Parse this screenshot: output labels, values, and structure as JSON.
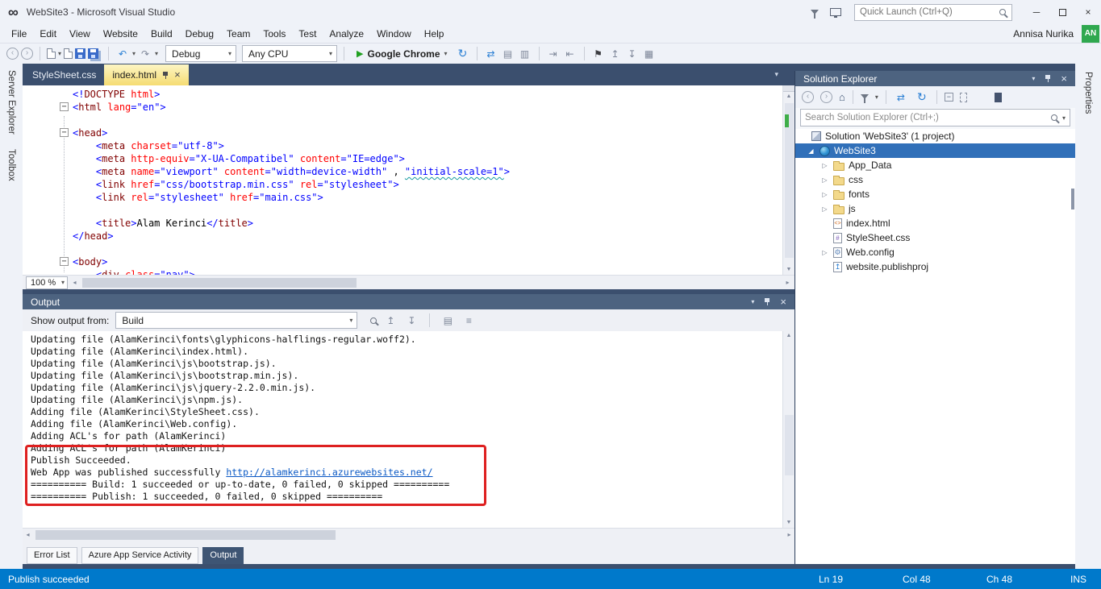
{
  "colors": {
    "frame_bg": "#3b4f6e",
    "chrome_bg": "#eff2f8",
    "panel_titlebar_bg": "#4d6380",
    "status_bar_bg": "#0079cb",
    "active_tab_top": "#fdf6c4",
    "active_tab_bottom": "#f5dc72",
    "selected_item": "#3170b9",
    "annotation_red": "#de2020",
    "avatar_green": "#2fa84f",
    "run_green": "#20a020",
    "link_blue": "#0a58c4"
  },
  "icons": {
    "infinity": "∞",
    "minimize": "─",
    "close": "×",
    "chevron_down": "▾",
    "arrow_up": "▲",
    "arrow_down": "▼",
    "arrow_left": "◂",
    "arrow_right": "▸",
    "back": "‹",
    "forward": "›",
    "undo": "↶",
    "redo": "↷",
    "refresh": "↻",
    "sync": "⇄",
    "home": "⌂",
    "bookmark": "⚑",
    "indent": "⇥",
    "outdent": "⇤",
    "down_bar": "↧",
    "up_bar": "↥",
    "list": "▤",
    "list2": "▥",
    "grid": "▦",
    "menu": "≡",
    "minus": "−",
    "play": "▶",
    "triangle_expanded": "◢",
    "triangle_collapsed": "▷"
  },
  "titlebar": {
    "title": "WebSite3 - Microsoft Visual Studio",
    "quick_launch_placeholder": "Quick Launch (Ctrl+Q)"
  },
  "menubar": {
    "items": [
      "File",
      "Edit",
      "View",
      "Website",
      "Build",
      "Debug",
      "Team",
      "Tools",
      "Test",
      "Analyze",
      "Window",
      "Help"
    ],
    "user_name": "Annisa Nurika",
    "avatar_initials": "AN"
  },
  "toolbar": {
    "config_dropdown": "Debug",
    "platform_dropdown": "Any CPU",
    "run_label": "Google Chrome"
  },
  "left_rail": {
    "tabs": [
      "Server Explorer",
      "Toolbox"
    ]
  },
  "right_rail": {
    "tabs": [
      "Properties"
    ]
  },
  "editor": {
    "tabs": [
      {
        "label": "StyleSheet.css",
        "active": false
      },
      {
        "label": "index.html",
        "active": true
      }
    ],
    "zoom": "100 %",
    "code_lines": [
      {
        "segs": [
          [
            "pu",
            "<!"
          ],
          [
            "tag",
            "DOCTYPE"
          ],
          [
            "pl",
            " "
          ],
          [
            "attr",
            "html"
          ],
          [
            "pu",
            ">"
          ]
        ]
      },
      {
        "fold": true,
        "segs": [
          [
            "pu",
            "<"
          ],
          [
            "tag",
            "html"
          ],
          [
            "pl",
            " "
          ],
          [
            "attr",
            "lang"
          ],
          [
            "pu",
            "="
          ],
          [
            "val",
            "\"en\""
          ],
          [
            "pu",
            ">"
          ]
        ]
      },
      {
        "segs": []
      },
      {
        "fold": true,
        "segs": [
          [
            "pu",
            "<"
          ],
          [
            "tag",
            "head"
          ],
          [
            "pu",
            ">"
          ]
        ]
      },
      {
        "segs": [
          [
            "pl",
            "    "
          ],
          [
            "pu",
            "<"
          ],
          [
            "tag",
            "meta"
          ],
          [
            "pl",
            " "
          ],
          [
            "attr",
            "charset"
          ],
          [
            "pu",
            "="
          ],
          [
            "val",
            "\"utf-8\""
          ],
          [
            "pu",
            ">"
          ]
        ]
      },
      {
        "segs": [
          [
            "pl",
            "    "
          ],
          [
            "pu",
            "<"
          ],
          [
            "tag",
            "meta"
          ],
          [
            "pl",
            " "
          ],
          [
            "attr",
            "http-equiv"
          ],
          [
            "pu",
            "="
          ],
          [
            "val",
            "\"X-UA-Compatibel\""
          ],
          [
            "pl",
            " "
          ],
          [
            "attr",
            "content"
          ],
          [
            "pu",
            "="
          ],
          [
            "val",
            "\"IE=edge\""
          ],
          [
            "pu",
            ">"
          ]
        ]
      },
      {
        "segs": [
          [
            "pl",
            "    "
          ],
          [
            "pu",
            "<"
          ],
          [
            "tag",
            "meta"
          ],
          [
            "pl",
            " "
          ],
          [
            "attr",
            "name"
          ],
          [
            "pu",
            "="
          ],
          [
            "val",
            "\"viewport\""
          ],
          [
            "pl",
            " "
          ],
          [
            "attr",
            "content"
          ],
          [
            "pu",
            "="
          ],
          [
            "val",
            "\"width=device-width\""
          ],
          [
            "pl",
            " , "
          ],
          [
            "warn",
            "\"initial-scale=1\""
          ],
          [
            "pu",
            ">"
          ]
        ]
      },
      {
        "segs": [
          [
            "pl",
            "    "
          ],
          [
            "pu",
            "<"
          ],
          [
            "tag",
            "link"
          ],
          [
            "pl",
            " "
          ],
          [
            "attr",
            "href"
          ],
          [
            "pu",
            "="
          ],
          [
            "val",
            "\"css/bootstrap.min.css\""
          ],
          [
            "pl",
            " "
          ],
          [
            "attr",
            "rel"
          ],
          [
            "pu",
            "="
          ],
          [
            "val",
            "\"stylesheet\""
          ],
          [
            "pu",
            ">"
          ]
        ]
      },
      {
        "segs": [
          [
            "pl",
            "    "
          ],
          [
            "pu",
            "<"
          ],
          [
            "tag",
            "link"
          ],
          [
            "pl",
            " "
          ],
          [
            "attr",
            "rel"
          ],
          [
            "pu",
            "="
          ],
          [
            "val",
            "\"stylesheet\""
          ],
          [
            "pl",
            " "
          ],
          [
            "attr",
            "href"
          ],
          [
            "pu",
            "="
          ],
          [
            "val",
            "\"main.css\""
          ],
          [
            "pu",
            ">"
          ]
        ]
      },
      {
        "segs": []
      },
      {
        "segs": [
          [
            "pl",
            "    "
          ],
          [
            "pu",
            "<"
          ],
          [
            "tag",
            "title"
          ],
          [
            "pu",
            ">"
          ],
          [
            "pl",
            "Alam Kerinci"
          ],
          [
            "pu",
            "</"
          ],
          [
            "tag",
            "title"
          ],
          [
            "pu",
            ">"
          ]
        ]
      },
      {
        "segs": [
          [
            "pu",
            "</"
          ],
          [
            "tag",
            "head"
          ],
          [
            "pu",
            ">"
          ]
        ]
      },
      {
        "segs": []
      },
      {
        "fold": true,
        "segs": [
          [
            "pu",
            "<"
          ],
          [
            "tag",
            "body"
          ],
          [
            "pu",
            ">"
          ]
        ]
      },
      {
        "segs": [
          [
            "pl",
            "    "
          ],
          [
            "pu",
            "<"
          ],
          [
            "tag",
            "div"
          ],
          [
            "pl",
            " "
          ],
          [
            "attr",
            "class"
          ],
          [
            "pu",
            "="
          ],
          [
            "val",
            "\"nav\""
          ],
          [
            "pu",
            ">"
          ]
        ]
      }
    ]
  },
  "output_panel": {
    "title": "Output",
    "show_output_from_label": "Show output from:",
    "source_dropdown": "Build",
    "lines": [
      {
        "segs": [
          [
            "ol",
            "Updating file (AlamKerinci\\fonts\\glyphicons-halflings-regular.woff2)."
          ]
        ]
      },
      {
        "segs": [
          [
            "ol",
            "Updating file (AlamKerinci\\index.html)."
          ]
        ]
      },
      {
        "segs": [
          [
            "ol",
            "Updating file (AlamKerinci\\js\\bootstrap.js)."
          ]
        ]
      },
      {
        "segs": [
          [
            "ol",
            "Updating file (AlamKerinci\\js\\bootstrap.min.js)."
          ]
        ]
      },
      {
        "segs": [
          [
            "ol",
            "Updating file (AlamKerinci\\js\\jquery-2.2.0.min.js)."
          ]
        ]
      },
      {
        "segs": [
          [
            "ol",
            "Updating file (AlamKerinci\\js\\npm.js)."
          ]
        ]
      },
      {
        "segs": [
          [
            "ol",
            "Adding file (AlamKerinci\\StyleSheet.css)."
          ]
        ]
      },
      {
        "segs": [
          [
            "ol",
            "Adding file (AlamKerinci\\Web.config)."
          ]
        ]
      },
      {
        "segs": [
          [
            "ol",
            "Adding ACL's for path (AlamKerinci)"
          ]
        ]
      },
      {
        "segs": [
          [
            "ol",
            "Adding ACL's for path (AlamKerinci)"
          ]
        ]
      },
      {
        "segs": [
          [
            "ol",
            "Publish Succeeded."
          ]
        ]
      },
      {
        "segs": [
          [
            "ol",
            "Web App was published successfully "
          ],
          [
            "link",
            "http://alamkerinci.azurewebsites.net/"
          ]
        ]
      },
      {
        "segs": [
          [
            "ol",
            "========== Build: 1 succeeded or up-to-date, 0 failed, 0 skipped =========="
          ]
        ]
      },
      {
        "segs": [
          [
            "ol",
            "========== Publish: 1 succeeded, 0 failed, 0 skipped =========="
          ]
        ]
      }
    ],
    "tabs": [
      "Error List",
      "Azure App Service Activity",
      "Output"
    ],
    "active_tab": "Output"
  },
  "solution_explorer": {
    "title": "Solution Explorer",
    "search_placeholder": "Search Solution Explorer (Ctrl+;)",
    "root": "Solution 'WebSite3' (1 project)",
    "items": [
      {
        "label": "WebSite3",
        "icon": "globe",
        "indent": 1,
        "expander": "expanded",
        "selected": true
      },
      {
        "label": "App_Data",
        "icon": "folder",
        "indent": 2,
        "expander": "collapsed"
      },
      {
        "label": "css",
        "icon": "folder",
        "indent": 2,
        "expander": "collapsed"
      },
      {
        "label": "fonts",
        "icon": "folder",
        "indent": 2,
        "expander": "collapsed"
      },
      {
        "label": "js",
        "icon": "folder",
        "indent": 2,
        "expander": "collapsed"
      },
      {
        "label": "index.html",
        "icon": "html",
        "indent": 2,
        "expander": ""
      },
      {
        "label": "StyleSheet.css",
        "icon": "css",
        "indent": 2,
        "expander": ""
      },
      {
        "label": "Web.config",
        "icon": "config",
        "indent": 2,
        "expander": "collapsed"
      },
      {
        "label": "website.publishproj",
        "icon": "pub",
        "indent": 2,
        "expander": ""
      }
    ]
  },
  "statusbar": {
    "message": "Publish succeeded",
    "ln": "Ln 19",
    "col": "Col 48",
    "ch": "Ch 48",
    "mode": "INS"
  }
}
